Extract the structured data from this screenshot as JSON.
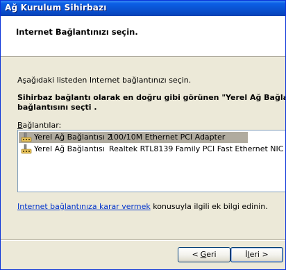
{
  "window": {
    "title": "Ağ Kurulum Sihirbazı"
  },
  "header": {
    "title": "Internet Bağlantınızı seçin."
  },
  "content": {
    "intro": "Aşağıdaki listeden Internet bağlantınızı seçin.",
    "recommendation_line1": "Sihirbaz bağlantı olarak en doğru gibi görünen \"Yerel Ağ Bağlantısı 2",
    "recommendation_line2": "bağlantısını seçti .",
    "list_label_prefix": "B",
    "list_label_rest": "ağlantılar:",
    "connections": [
      {
        "name": "Yerel Ağ Bağlantısı 2",
        "adapter": "100/10M Ethernet PCI Adapter",
        "selected": true
      },
      {
        "name": "Yerel Ağ Bağlantısı",
        "adapter": "Realtek RTL8139 Family PCI Fast Ethernet NIC",
        "selected": false
      }
    ],
    "info_link": "Internet bağlantınıza karar vermek",
    "info_rest": " konusuyla ilgili ek bilgi edinin."
  },
  "buttons": {
    "back_arrow": "<",
    "back_underlined": "G",
    "back_rest": "eri",
    "next_prefix": "İ",
    "next_underlined": "l",
    "next_rest": "eri",
    "next_arrow": ">"
  },
  "colors": {
    "titlebar": "#0a54d4",
    "link": "#0033cc",
    "selection": "#b0ab9f"
  }
}
